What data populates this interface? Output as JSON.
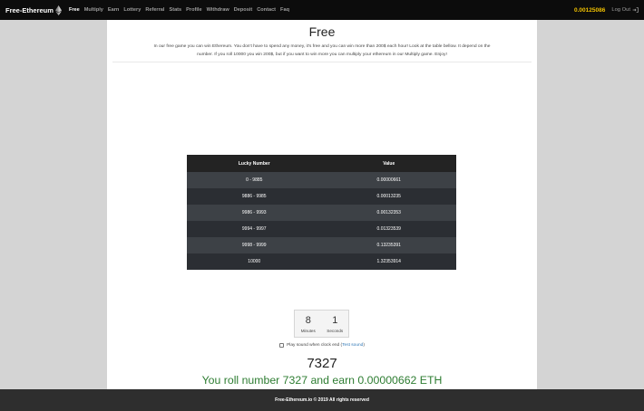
{
  "navbar": {
    "brand": "Free-Ethereum",
    "links": [
      {
        "label": "Free",
        "active": true
      },
      {
        "label": "Multiply"
      },
      {
        "label": "Earn"
      },
      {
        "label": "Lottery"
      },
      {
        "label": "Referral"
      },
      {
        "label": "Stats"
      },
      {
        "label": "Profile"
      },
      {
        "label": "Withdraw"
      },
      {
        "label": "Deposit"
      },
      {
        "label": "Contact"
      },
      {
        "label": "Faq"
      }
    ],
    "balance": "0.00125086",
    "logout": "Log Out"
  },
  "main": {
    "title": "Free",
    "description_line1": "In our free game you can win Ethereum. You don't have to spend any money, it's free and you can win more than 200$ each hour! Look at the table bellow. It depend on the",
    "description_line2": "number. If you roll 10000 you win 200$, but if you want to win more you can multiply your ethereum in our Multiply game. Enjoy!"
  },
  "table": {
    "headers": [
      "Lucky Number",
      "Value"
    ],
    "rows": [
      {
        "range": "0 - 9885",
        "value": "0.00000661"
      },
      {
        "range": "9886 - 9985",
        "value": "0.00013235"
      },
      {
        "range": "9986 - 9993",
        "value": "0.00132353"
      },
      {
        "range": "9994 - 9997",
        "value": "0.01323539"
      },
      {
        "range": "9998 - 9999",
        "value": "0.13235391"
      },
      {
        "range": "10000",
        "value": "1.32353914"
      }
    ]
  },
  "countdown": {
    "minutes": "8",
    "minutes_label": "Minutes",
    "seconds": "1",
    "seconds_label": "Seconds"
  },
  "sound": {
    "label": "Play sound when clock end (",
    "test_link": "Test sound",
    "close": ")",
    "checked": false
  },
  "result": {
    "number": "7327",
    "message": "You roll number 7327 and earn 0.00000662 ETH"
  },
  "footer": {
    "text": "Free-Ethereum.io © 2019 All rights reserved"
  },
  "colors": {
    "balance": "#f0c000",
    "result": "#2e7d32",
    "link": "#337ab7"
  }
}
